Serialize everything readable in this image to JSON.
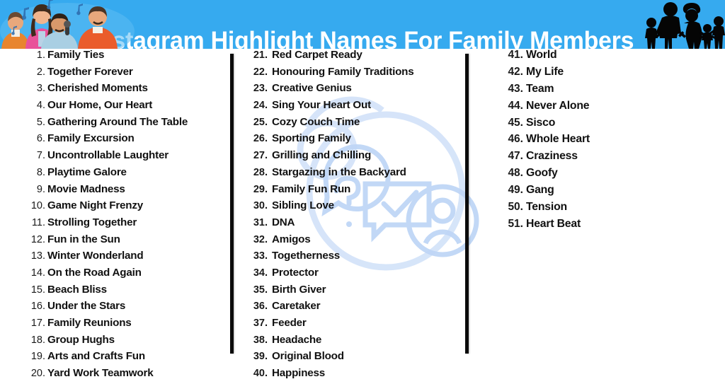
{
  "header": {
    "title": "Instagram Highlight Names For Family Members",
    "background_color": "#36aaef",
    "title_color": "#ffffff",
    "left_illustration": "cartoon-family-singing-karaoke",
    "right_illustration": "family-silhouettes"
  },
  "watermark": {
    "icons": [
      "question-mark-speech-bubble",
      "checkmark-message-box",
      "user-avatar-circle"
    ],
    "color": "#c9ddf7"
  },
  "dividers": {
    "count": 2,
    "color": "#0b0b0b"
  },
  "columns": [
    {
      "name": "column-1",
      "items": [
        {
          "num": "1.",
          "text": "Family Ties"
        },
        {
          "num": "2.",
          "text": "Together Forever"
        },
        {
          "num": "3.",
          "text": "Cherished Moments"
        },
        {
          "num": "4.",
          "text": "Our Home, Our Heart"
        },
        {
          "num": "5.",
          "text": "Gathering Around The Table"
        },
        {
          "num": "6.",
          "text": "Family Excursion"
        },
        {
          "num": "7.",
          "text": "Uncontrollable Laughter"
        },
        {
          "num": "8.",
          "text": "Playtime Galore"
        },
        {
          "num": "9.",
          "text": "Movie Madness"
        },
        {
          "num": "10.",
          "text": "Game Night Frenzy"
        },
        {
          "num": "11.",
          "text": "Strolling Together"
        },
        {
          "num": "12.",
          "text": "Fun in the Sun"
        },
        {
          "num": "13.",
          "text": "Winter Wonderland"
        },
        {
          "num": "14.",
          "text": "On the Road Again"
        },
        {
          "num": "15.",
          "text": "Beach Bliss"
        },
        {
          "num": "16.",
          "text": "Under the Stars"
        },
        {
          "num": "17.",
          "text": "Family Reunions"
        },
        {
          "num": "18.",
          "text": "Group Hughs"
        },
        {
          "num": "19.",
          "text": "Arts and Crafts Fun"
        },
        {
          "num": "20.",
          "text": "Yard Work Teamwork"
        }
      ]
    },
    {
      "name": "column-2",
      "items": [
        {
          "num": "21.",
          "text": "Red Carpet Ready"
        },
        {
          "num": "22.",
          "text": "Honouring Family Traditions"
        },
        {
          "num": "23.",
          "text": "Creative Genius"
        },
        {
          "num": "24.",
          "text": "Sing Your Heart Out"
        },
        {
          "num": "25.",
          "text": "Cozy Couch Time"
        },
        {
          "num": "26.",
          "text": "Sporting Family"
        },
        {
          "num": "27.",
          "text": "Grilling and Chilling"
        },
        {
          "num": "28.",
          "text": "Stargazing in the Backyard"
        },
        {
          "num": "29.",
          "text": "Family Fun Run"
        },
        {
          "num": "30.",
          "text": "Sibling Love"
        },
        {
          "num": "31.",
          "text": "DNA"
        },
        {
          "num": "32.",
          "text": "Amigos"
        },
        {
          "num": "33.",
          "text": "Togetherness"
        },
        {
          "num": "34.",
          "text": "Protector"
        },
        {
          "num": "35.",
          "text": "Birth Giver"
        },
        {
          "num": "36.",
          "text": "Caretaker"
        },
        {
          "num": "37.",
          "text": "Feeder"
        },
        {
          "num": "38.",
          "text": "Headache"
        },
        {
          "num": "39.",
          "text": "Original Blood"
        },
        {
          "num": "40.",
          "text": "Happiness"
        }
      ]
    },
    {
      "name": "column-3",
      "items": [
        {
          "num": "41.",
          "text": "World"
        },
        {
          "num": "42.",
          "text": "My Life"
        },
        {
          "num": "43.",
          "text": "Team"
        },
        {
          "num": "44.",
          "text": "Never Alone"
        },
        {
          "num": "45.",
          "text": "Sisco"
        },
        {
          "num": "46.",
          "text": "Whole Heart"
        },
        {
          "num": "47.",
          "text": "Craziness"
        },
        {
          "num": "48.",
          "text": "Goofy"
        },
        {
          "num": "49.",
          "text": "Gang"
        },
        {
          "num": "50.",
          "text": "Tension"
        },
        {
          "num": "51.",
          "text": "Heart Beat"
        }
      ]
    }
  ]
}
